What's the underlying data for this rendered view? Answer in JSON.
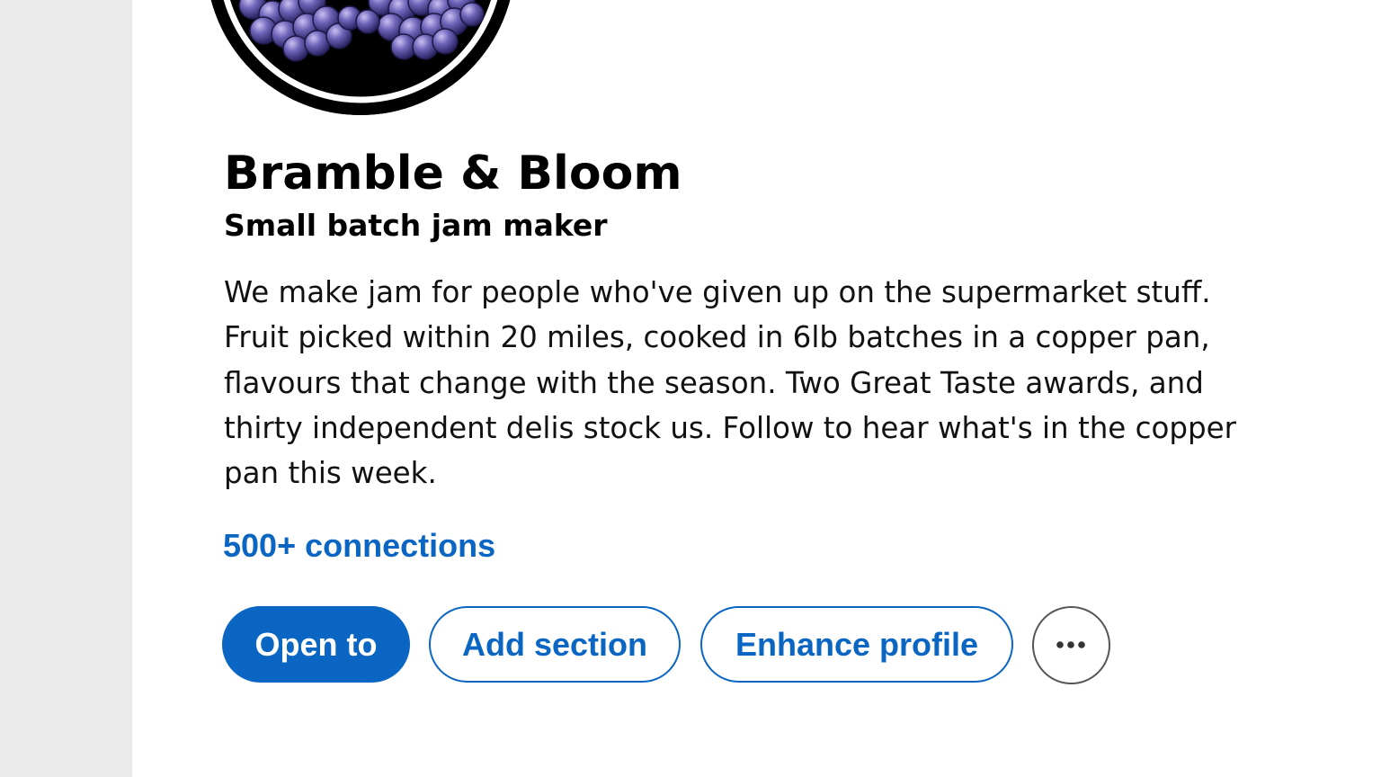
{
  "profile": {
    "name": "Bramble & Bloom",
    "headline": "Small batch jam maker",
    "about": "We make jam for people who've given up on the supermarket stuff. Fruit picked within 20 miles, cooked in 6lb batches in a copper pan, flavours that change with the season. Two Great Taste awards, and thirty independent delis stock us. Follow to hear what's in the copper pan this week.",
    "connections": "500+ connections",
    "avatar_icon": "blackberries-illustration"
  },
  "actions": {
    "open_to": "Open to",
    "add_section": "Add section",
    "enhance_profile": "Enhance profile",
    "more_icon": "more-horizontal-icon"
  },
  "colors": {
    "accent": "#0a66c2",
    "page_background": "#eaeaea",
    "card_background": "#ffffff",
    "text": "#000000"
  }
}
